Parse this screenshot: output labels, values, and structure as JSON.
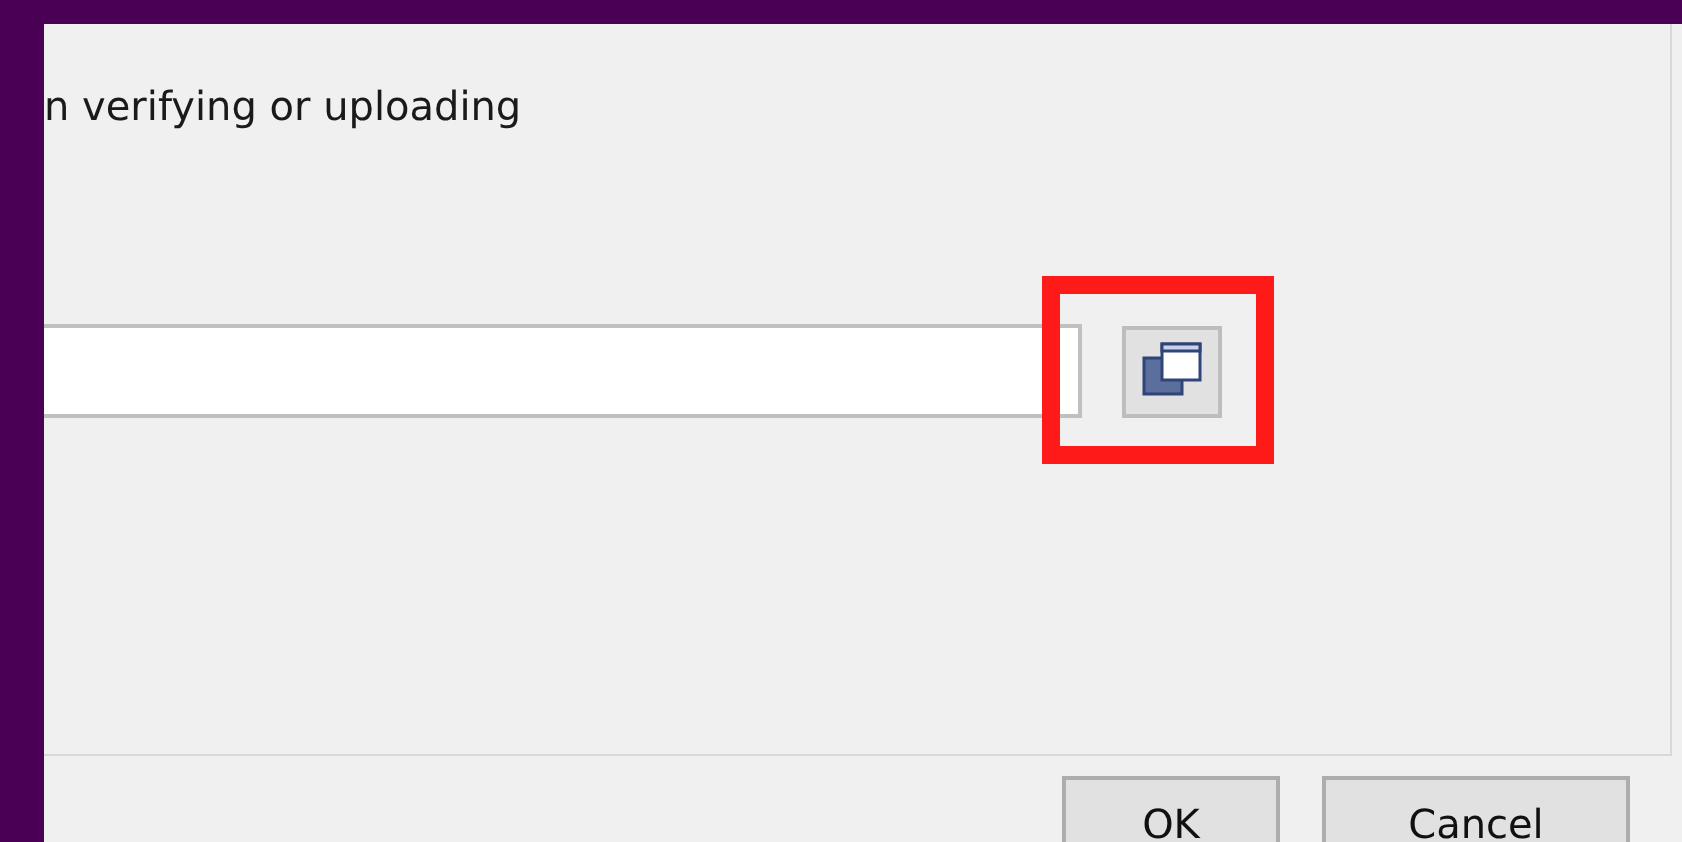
{
  "dialog": {
    "message": "n verifying or uploading",
    "browse_button": {
      "highlighted": true
    },
    "buttons": [
      {
        "label": "OK"
      },
      {
        "label": "Cancel"
      }
    ]
  }
}
